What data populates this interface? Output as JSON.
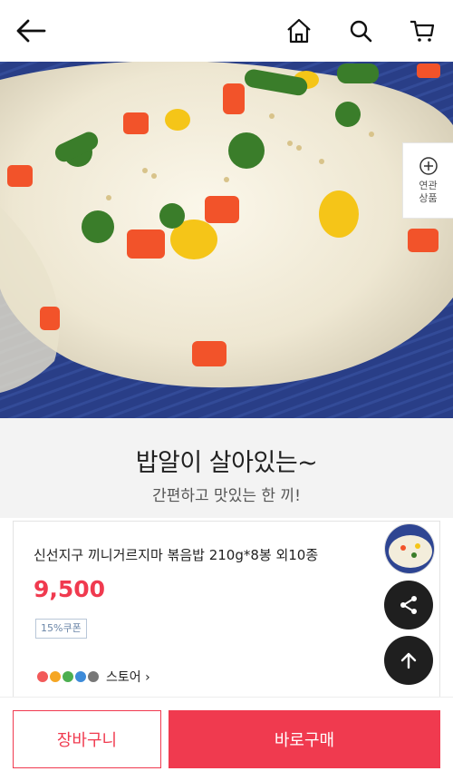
{
  "header": {
    "icons": [
      "back-arrow-icon",
      "home-icon",
      "search-icon",
      "cart-icon"
    ]
  },
  "related": {
    "label_line1": "연관",
    "label_line2": "상품"
  },
  "promo": {
    "headline": "밥알이 살아있는~",
    "subheadline": "간편하고 맛있는 한 끼!"
  },
  "product": {
    "name": "신선지구 끼니거르지마 볶음밥 210g*8봉 외10종",
    "price": "9,500",
    "coupon": "15%쿠폰",
    "store_label": "스토어 ›"
  },
  "actions": {
    "cart_label": "장바구니",
    "buy_label": "바로구매"
  },
  "colors": {
    "accent": "#f03a4f",
    "fab": "#1f1f1f"
  }
}
